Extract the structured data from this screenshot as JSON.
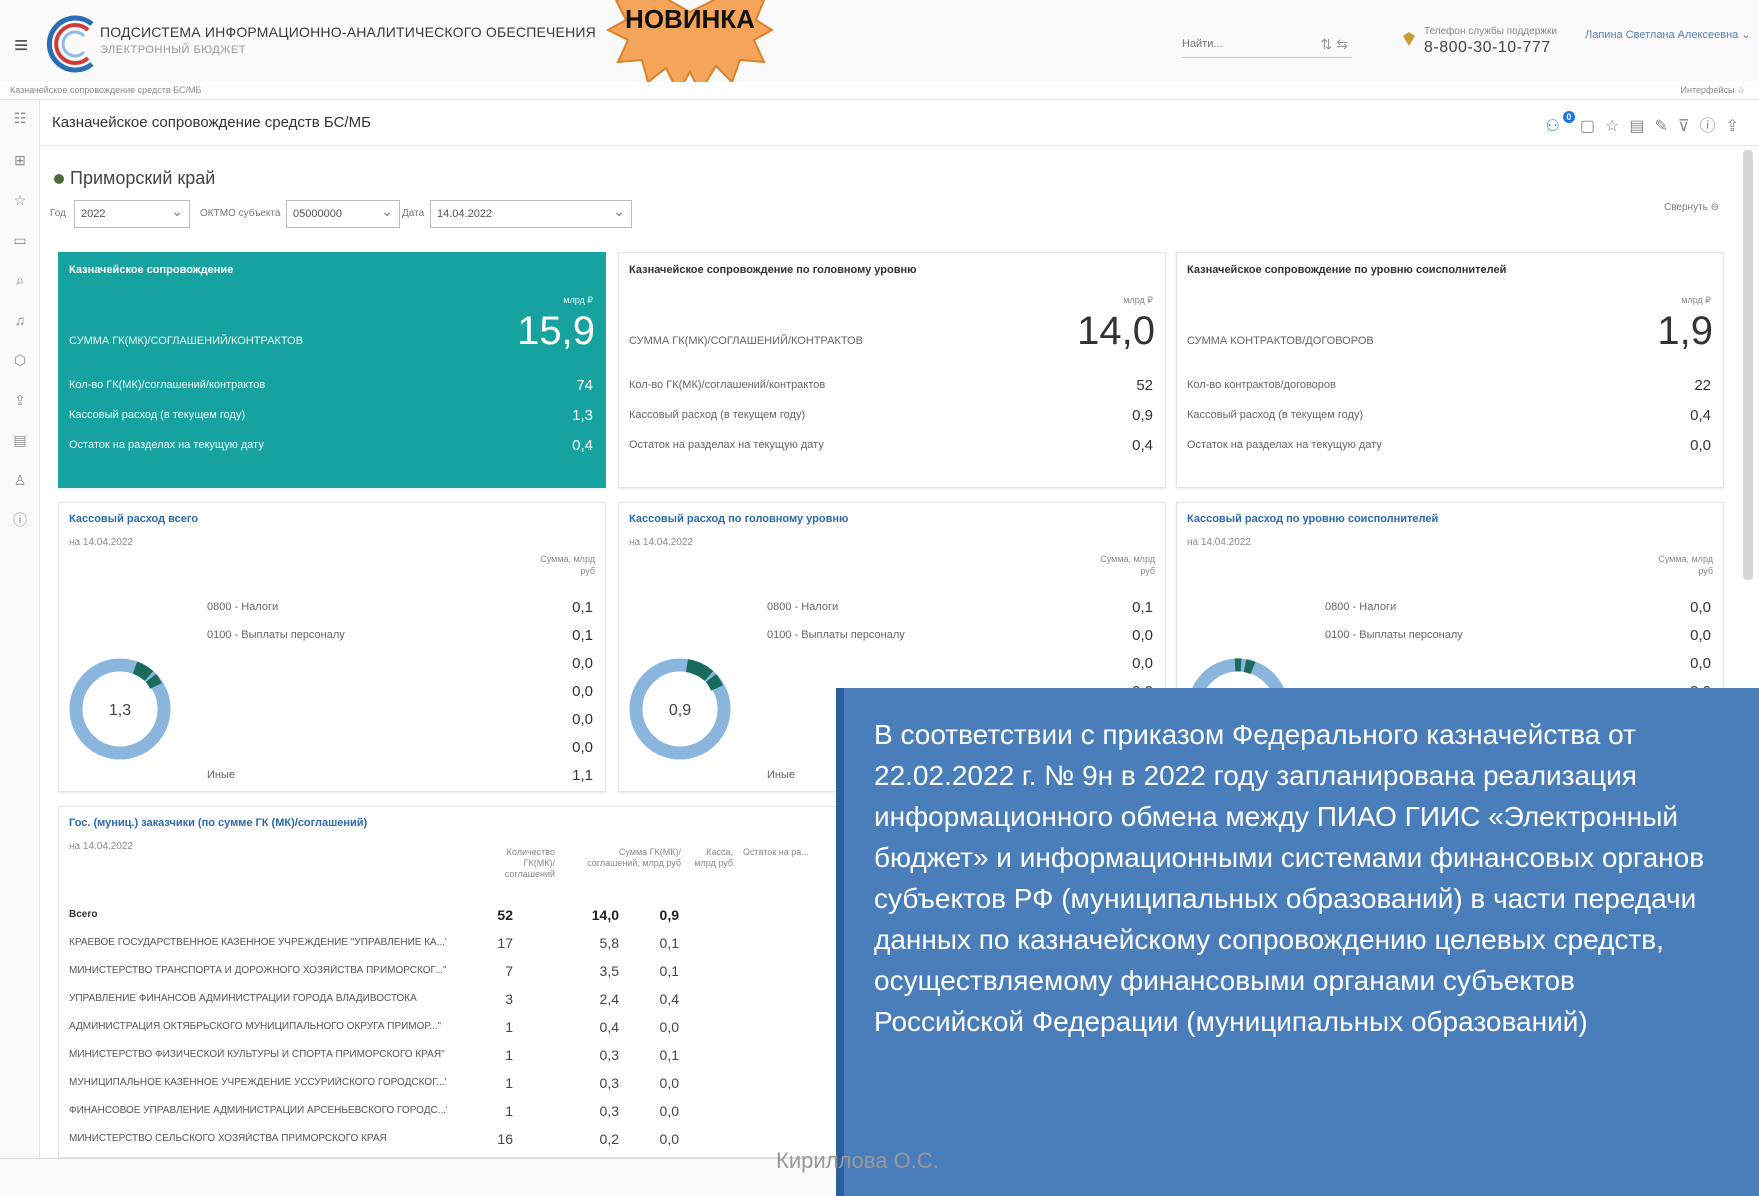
{
  "header": {
    "system_title": "ПОДСИСТЕМА ИНФОРМАЦИОННО-АНАЛИТИЧЕСКОГО ОБЕСПЕЧЕНИЯ",
    "system_subtitle": "ЭЛЕКТРОННЫЙ БЮДЖЕТ",
    "search_placeholder": "Найти...",
    "support_label": "Телефон службы поддержки",
    "support_phone": "8-800-30-10-777",
    "user_name": "Лапина Светлана Алексеевна"
  },
  "badge": {
    "text": "НОВИНКА"
  },
  "breadcrumb": "Казначейское сопровождение средств БС/МБ",
  "interfaces_label": "Интерфейсы",
  "page": {
    "title": "Казначейское сопровождение средств БС/МБ",
    "notification_count": "0",
    "region": "Приморский край",
    "collapse_label": "Свернуть"
  },
  "filters": {
    "year_label": "Год",
    "year_value": "2022",
    "oktmo_label": "ОКТМО субъекта",
    "oktmo_value": "05000000",
    "date_label": "Дата",
    "date_value": "14.04.2022"
  },
  "summary_cards": [
    {
      "title": "Казначейское сопровождение",
      "unit": "млрд ₽",
      "sum_label": "СУММА ГК(МК)/СОГЛАШЕНИЙ/КОНТРАКТОВ",
      "sum_value": "15,9",
      "rows": [
        {
          "label": "Кол-во ГК(МК)/соглашений/контрактов",
          "value": "74"
        },
        {
          "label": "Кассовый расход (в текущем году)",
          "value": "1,3"
        },
        {
          "label": "Остаток на разделах на текущую дату",
          "value": "0,4"
        }
      ]
    },
    {
      "title": "Казначейское сопровождение по головному уровню",
      "unit": "млрд ₽",
      "sum_label": "СУММА ГК(МК)/СОГЛАШЕНИЙ/КОНТРАКТОВ",
      "sum_value": "14,0",
      "rows": [
        {
          "label": "Кол-во ГК(МК)/соглашений/контрактов",
          "value": "52"
        },
        {
          "label": "Кассовый расход (в текущем году)",
          "value": "0,9"
        },
        {
          "label": "Остаток на разделах на текущую дату",
          "value": "0,4"
        }
      ]
    },
    {
      "title": "Казначейское сопровождение по уровню соисполнителей",
      "unit": "млрд ₽",
      "sum_label": "СУММА КОНТРАКТОВ/ДОГОВОРОВ",
      "sum_value": "1,9",
      "rows": [
        {
          "label": "Кол-во контрактов/договоров",
          "value": "22"
        },
        {
          "label": "Кассовый расход (в текущем году)",
          "value": "0,4"
        },
        {
          "label": "Остаток на разделах на текущую дату",
          "value": "0,0"
        }
      ]
    }
  ],
  "donut_cards": [
    {
      "title": "Кассовый расход всего",
      "date": "на 14.04.2022",
      "col_header": "Сумма, млрд руб",
      "center_value": "1,3",
      "items": [
        {
          "label": "0800 - Налоги",
          "value": "0,1"
        },
        {
          "label": "0100 - Выплаты персоналу",
          "value": "0,1"
        },
        {
          "label": "",
          "value": "0,0"
        },
        {
          "label": "",
          "value": "0,0"
        },
        {
          "label": "",
          "value": "0,0"
        },
        {
          "label": "",
          "value": "0,0"
        },
        {
          "label": "Иные",
          "value": "1,1"
        }
      ]
    },
    {
      "title": "Кассовый расход по головному уровню",
      "date": "на 14.04.2022",
      "col_header": "Сумма, млрд руб",
      "center_value": "0,9",
      "items": [
        {
          "label": "0800 - Налоги",
          "value": "0,1"
        },
        {
          "label": "0100 - Выплаты персоналу",
          "value": "0,0"
        },
        {
          "label": "",
          "value": "0,0"
        },
        {
          "label": "",
          "value": "0,0"
        },
        {
          "label": "Иные",
          "value": ""
        }
      ]
    },
    {
      "title": "Кассовый расход по уровню соисполнителей",
      "date": "на 14.04.2022",
      "col_header": "Сумма, млрд руб",
      "center_value": "",
      "items": [
        {
          "label": "0800 - Налоги",
          "value": "0,0"
        },
        {
          "label": "0100 - Выплаты персоналу",
          "value": "0,0"
        },
        {
          "label": "",
          "value": "0,0"
        },
        {
          "label": "",
          "value": "0,0"
        }
      ]
    }
  ],
  "table": {
    "title": "Гос. (муниц.) заказчики (по сумме ГК (МК)/соглашений)",
    "date": "на 14.04.2022",
    "headers": [
      "Количество ГК(МК)/ соглашений",
      "Сумма ГК(МК)/ соглашений, млрд руб",
      "Касса, млрд руб",
      "Остаток на ра..."
    ],
    "rows": [
      {
        "name": "Всего",
        "count": "52",
        "sum": "14,0",
        "cash": "0,9"
      },
      {
        "name": "КРАЕВОЕ ГОСУДАРСТВЕННОЕ КАЗЕННОЕ УЧРЕЖДЕНИЕ \"УПРАВЛЕНИЕ КА...\"",
        "count": "17",
        "sum": "5,8",
        "cash": "0,1"
      },
      {
        "name": "МИНИСТЕРСТВО ТРАНСПОРТА И ДОРОЖНОГО ХОЗЯЙСТВА ПРИМОРСКОГ...\"",
        "count": "7",
        "sum": "3,5",
        "cash": "0,1"
      },
      {
        "name": "УПРАВЛЕНИЕ ФИНАНСОВ АДМИНИСТРАЦИИ ГОРОДА ВЛАДИВОСТОКА",
        "count": "3",
        "sum": "2,4",
        "cash": "0,4"
      },
      {
        "name": "АДМИНИСТРАЦИЯ ОКТЯБРЬСКОГО МУНИЦИПАЛЬНОГО ОКРУГА ПРИМОР...\"",
        "count": "1",
        "sum": "0,4",
        "cash": "0,0"
      },
      {
        "name": "МИНИСТЕРСТВО ФИЗИЧЕСКОЙ КУЛЬТУРЫ И СПОРТА ПРИМОРСКОГО КРАЯ\"",
        "count": "1",
        "sum": "0,3",
        "cash": "0,1"
      },
      {
        "name": "МУНИЦИПАЛЬНОЕ КАЗЁННОЕ УЧРЕЖДЕНИЕ УССУРИЙСКОГО ГОРОДСКОГ...\"",
        "count": "1",
        "sum": "0,3",
        "cash": "0,0"
      },
      {
        "name": "ФИНАНСОВОЕ УПРАВЛЕНИЕ АДМИНИСТРАЦИИ АРСЕНЬЕВСКОГО ГОРОДС...\"",
        "count": "1",
        "sum": "0,3",
        "cash": "0,0"
      },
      {
        "name": "МИНИСТЕРСТВО СЕЛЬСКОГО ХОЗЯЙСТВА ПРИМОРСКОГО КРАЯ",
        "count": "16",
        "sum": "0,2",
        "cash": "0,0"
      }
    ]
  },
  "note": {
    "text": "В соответствии с приказом Федерального казначейства от 22.02.2022 г. № 9н в 2022 году запланирована реализация информационного обмена между ПИАО ГИИС «Электронный бюджет» и информационными системами финансовых органов субъектов РФ (муниципальных образований) в части передачи данных по казначейскому сопровождению целевых средств, осуществляемому финансовыми органами субъектов Российской Федерации (муниципальных образований)"
  },
  "author": "Кириллова О.С.",
  "colors": {
    "teal_card": "#16a3a0",
    "note_bg": "#4a7ebb",
    "link": "#2c6ab0",
    "donut_main": "#8ab6de",
    "donut_dark": "#1a6b5c",
    "star_fill": "#f5a55a"
  }
}
